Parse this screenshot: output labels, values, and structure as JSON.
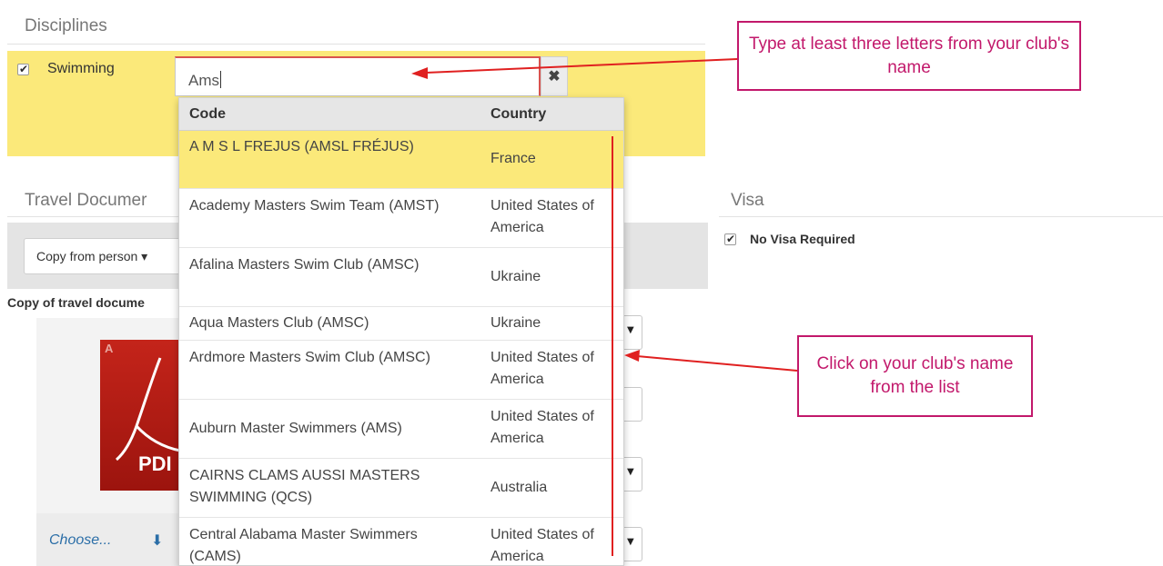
{
  "disciplines": {
    "title": "Disciplines",
    "swimming_label": "Swimming",
    "swimming_checked": true
  },
  "club_search": {
    "value": "Ams",
    "clear_icon": "close-icon",
    "columns": {
      "code": "Code",
      "country": "Country"
    },
    "results": [
      {
        "code": "A M S L FREJUS (AMSL FRÉJUS)",
        "country": "France",
        "selected": true
      },
      {
        "code": "Academy Masters Swim Team (AMST)",
        "country": "United States of America"
      },
      {
        "code": "Afalina Masters Swim Club (AMSC)",
        "country": "Ukraine"
      },
      {
        "code": "Aqua Masters Club (AMSC)",
        "country": "Ukraine"
      },
      {
        "code": "Ardmore Masters Swim Club (AMSC)",
        "country": "United States of America"
      },
      {
        "code": "Auburn Master Swimmers (AMS)",
        "country": "United States of America"
      },
      {
        "code": "CAIRNS CLAMS AUSSI MASTERS SWIMMING (QCS)",
        "country": "Australia"
      },
      {
        "code": "Central Alabama Master Swimmers (CAMS)",
        "country": "United States of America"
      }
    ]
  },
  "travel": {
    "title": "Travel Documer",
    "copy_button": "Copy from person",
    "copy_label": "Copy of travel docume",
    "pdf_text": "PDI",
    "choose_link": "Choose...",
    "download_icon": "download-icon"
  },
  "visa": {
    "title": "Visa",
    "no_visa_label": "No Visa Required",
    "no_visa_checked": true
  },
  "annotations": {
    "type_hint": "Type at least three letters from your club's name",
    "click_hint": "Click on your club's name from the list"
  },
  "colors": {
    "highlight": "#fbe97a",
    "annotation": "#c2186b",
    "arrow": "#e02020"
  }
}
